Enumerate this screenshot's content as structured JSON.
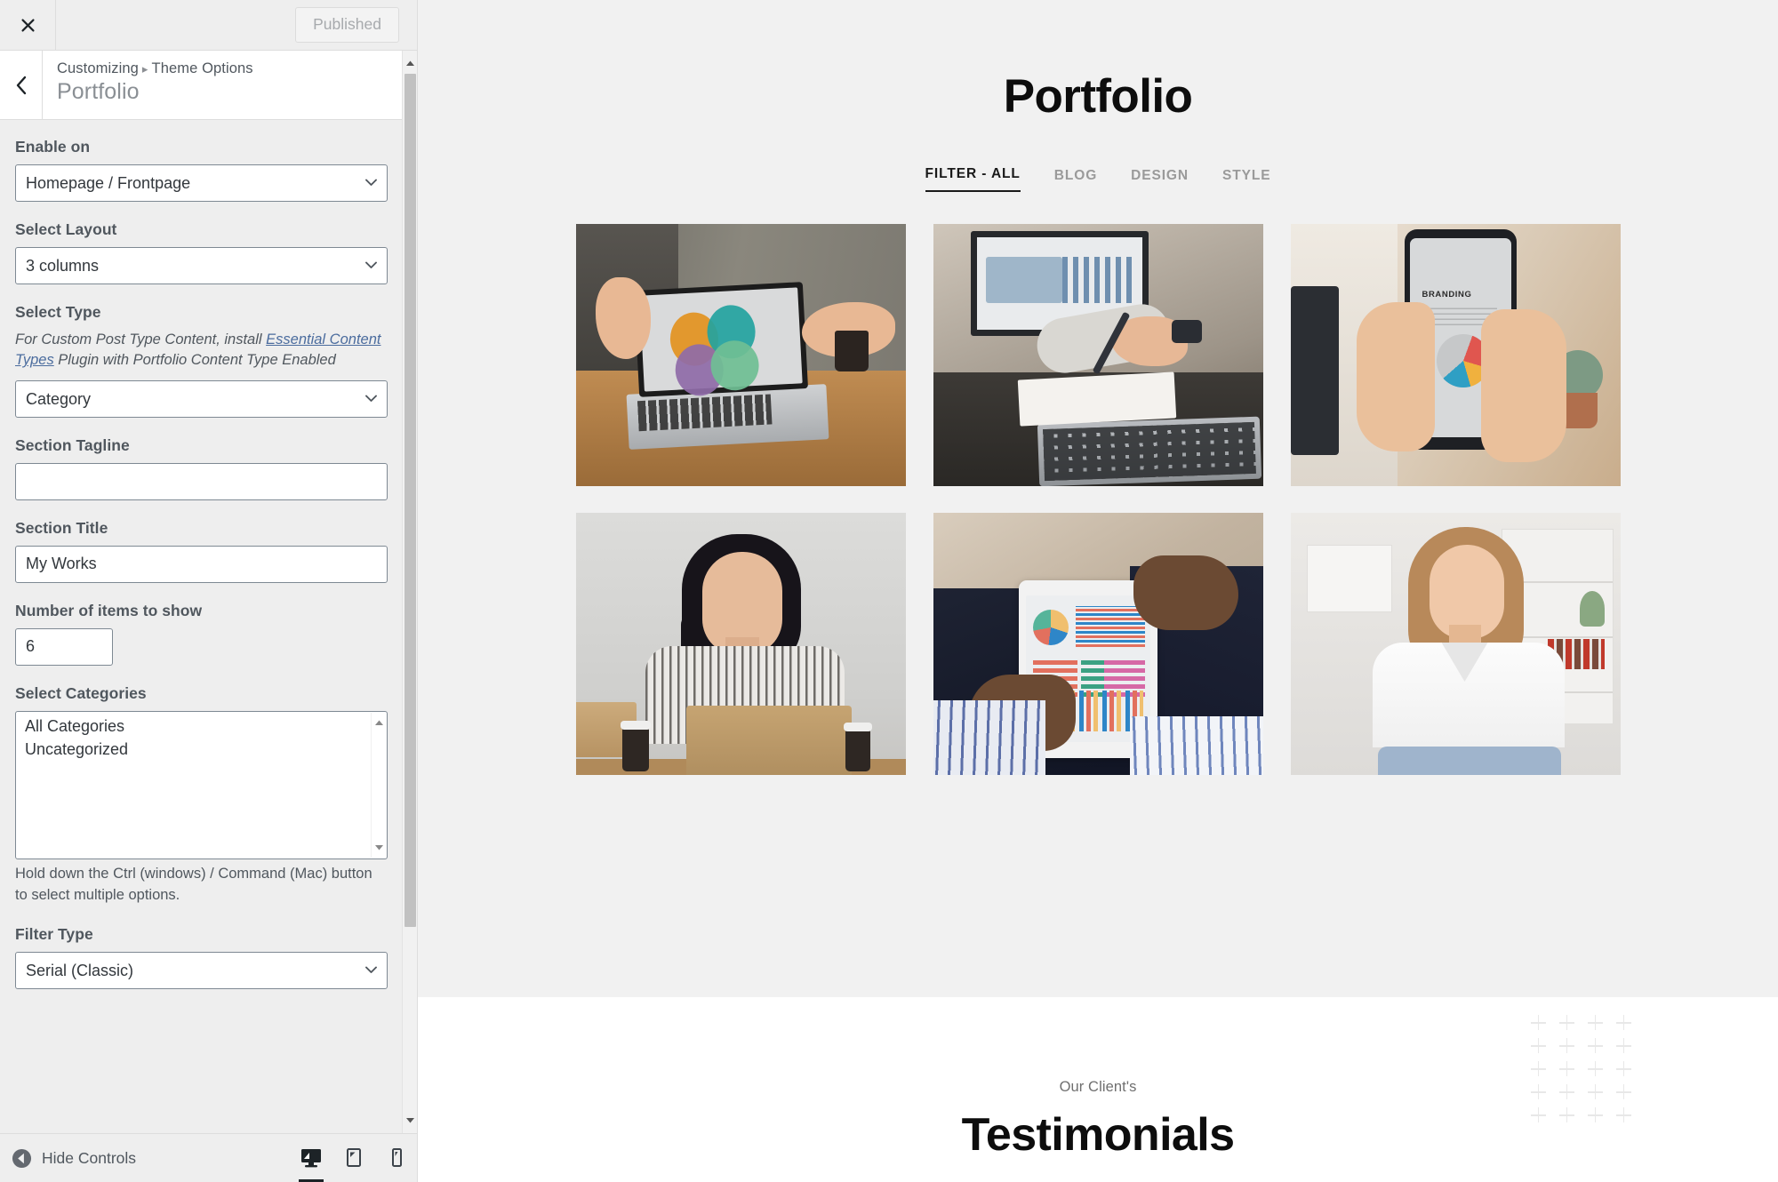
{
  "customizer": {
    "topbar": {
      "close_icon": "close-x-icon",
      "publish_label": "Published"
    },
    "header": {
      "back_icon": "chevron-left-icon",
      "breadcrumb_root": "Customizing",
      "breadcrumb_separator": "▸",
      "breadcrumb_parent": "Theme Options",
      "panel_title": "Portfolio"
    },
    "controls": [
      {
        "id": "enable-on",
        "label": "Enable on",
        "type": "select",
        "value": "Homepage / Frontpage"
      },
      {
        "id": "select-layout",
        "label": "Select Layout",
        "type": "select",
        "value": "3 columns"
      },
      {
        "id": "select-type",
        "label": "Select Type",
        "type": "select",
        "value": "Category",
        "description_before": "For Custom Post Type Content, install ",
        "description_link": "Essential Content Types",
        "description_after": " Plugin with Portfolio Content Type Enabled"
      },
      {
        "id": "section-tagline",
        "label": "Section Tagline",
        "type": "text",
        "value": ""
      },
      {
        "id": "section-title",
        "label": "Section Title",
        "type": "text",
        "value": "My Works"
      },
      {
        "id": "number-of-items",
        "label": "Number of items to show",
        "type": "number",
        "value": "6"
      },
      {
        "id": "select-categories",
        "label": "Select Categories",
        "type": "listbox",
        "options": [
          "All Categories",
          "Uncategorized"
        ],
        "help": "Hold down the Ctrl (windows) / Command (Mac) button to select multiple options."
      },
      {
        "id": "filter-type",
        "label": "Filter Type",
        "type": "select",
        "value": "Serial (Classic)"
      }
    ],
    "footer": {
      "hide_controls_label": "Hide Controls",
      "hide_controls_icon": "collapse-arrow-icon",
      "devices": [
        {
          "name": "desktop",
          "icon": "desktop-icon",
          "active": true
        },
        {
          "name": "tablet",
          "icon": "tablet-icon",
          "active": false
        },
        {
          "name": "mobile",
          "icon": "mobile-icon",
          "active": false
        }
      ]
    }
  },
  "preview": {
    "portfolio": {
      "title": "Portfolio",
      "filters": [
        {
          "label": "FILTER - ALL",
          "active": true
        },
        {
          "label": "BLOG",
          "active": false
        },
        {
          "label": "DESIGN",
          "active": false
        },
        {
          "label": "STYLE",
          "active": false
        }
      ],
      "items": [
        {
          "alt": "Laptop on wooden desk showing a colorful SWOT venn diagram"
        },
        {
          "alt": "Hands writing in a notebook beside a laptop with a dashboard"
        },
        {
          "alt": "Hands holding a smartphone showing a BRANDING page with a pie chart"
        },
        {
          "alt": "Woman in striped blouse sitting at a desk with a laptop"
        },
        {
          "alt": "Man in a suit holding a tablet with colorful charts and a stylus"
        },
        {
          "alt": "Smiling woman in a white blouse in a bright office"
        }
      ]
    },
    "testimonials": {
      "tagline": "Our Client's",
      "title": "Testimonials",
      "decoration_icon": "plus-grid-pattern",
      "decoration_rows": 5,
      "decoration_cols": 4
    }
  },
  "colors": {
    "panel_bg": "#eeeeee",
    "panel_header_bg": "#ffffff",
    "text": "#50575e",
    "link": "#4b6c9e",
    "section_bg": "#f1f1f1",
    "accent": "#1a1a1a",
    "muted": "#9a9a9a"
  }
}
